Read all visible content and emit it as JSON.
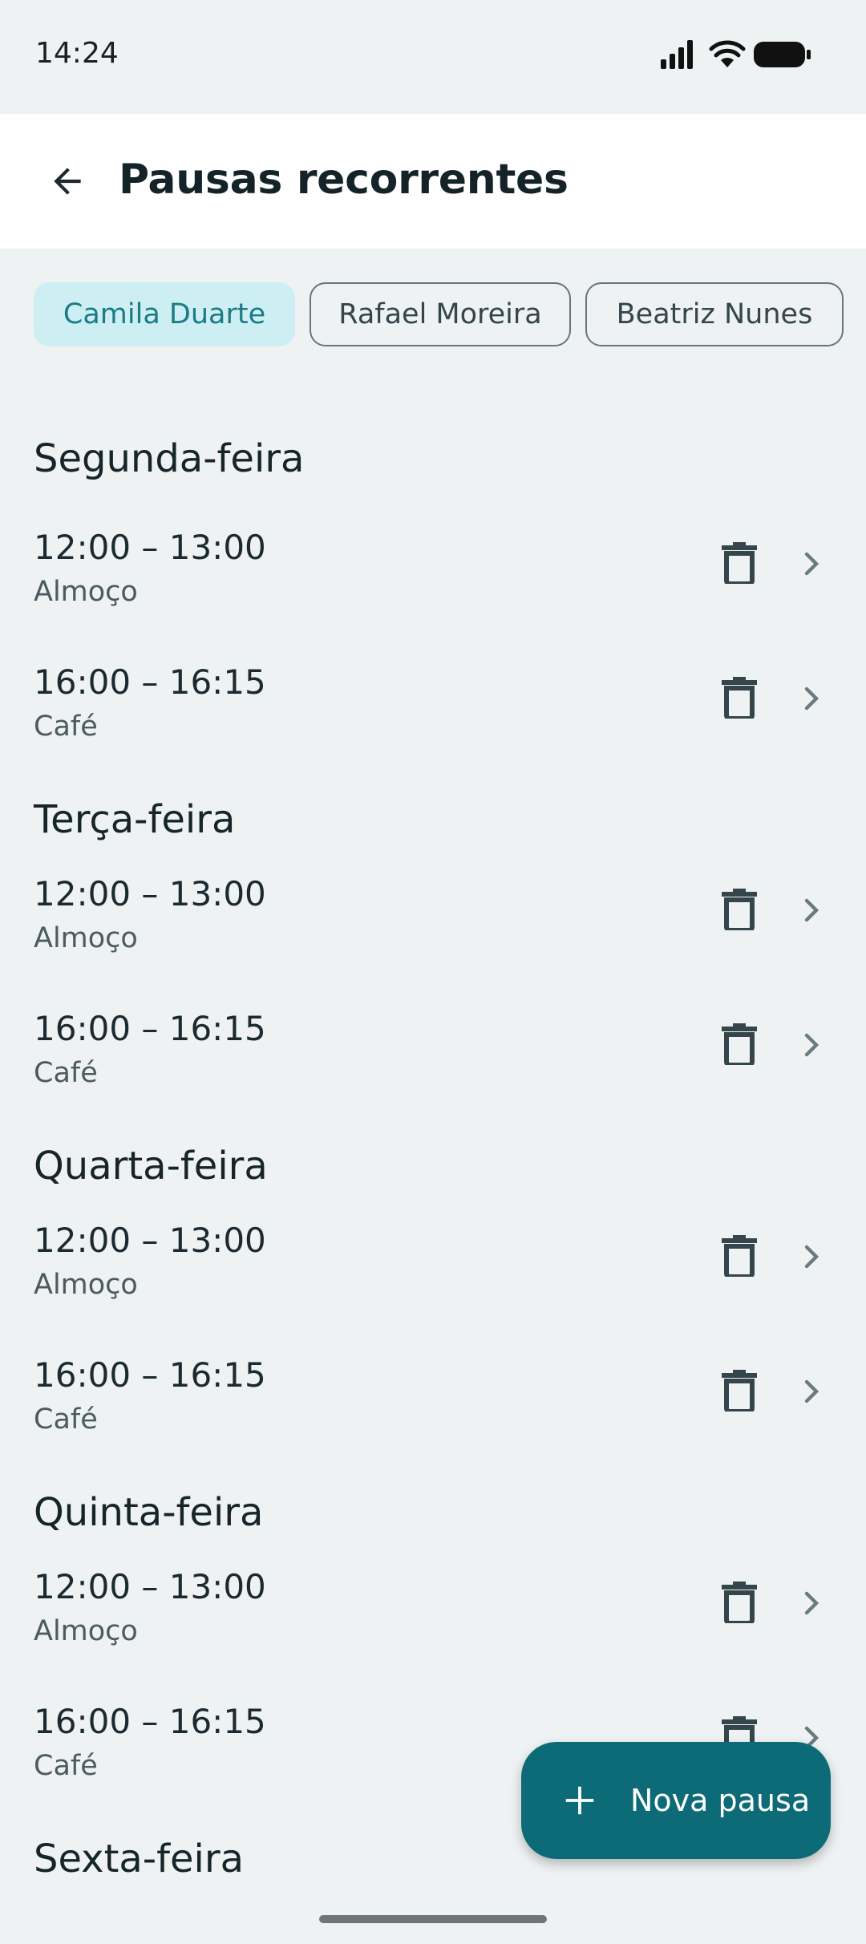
{
  "status_bar": {
    "time": "14:24"
  },
  "header": {
    "title": "Pausas recorrentes"
  },
  "chips": [
    {
      "label": "Camila Duarte",
      "selected": true
    },
    {
      "label": "Rafael Moreira",
      "selected": false
    },
    {
      "label": "Beatriz Nunes",
      "selected": false
    }
  ],
  "days": [
    {
      "name": "Segunda-feira",
      "breaks": [
        {
          "time": "12:00 – 13:00",
          "label": "Almoço"
        },
        {
          "time": "16:00 – 16:15",
          "label": "Café"
        }
      ]
    },
    {
      "name": "Terça-feira",
      "breaks": [
        {
          "time": "12:00 – 13:00",
          "label": "Almoço"
        },
        {
          "time": "16:00 – 16:15",
          "label": "Café"
        }
      ]
    },
    {
      "name": "Quarta-feira",
      "breaks": [
        {
          "time": "12:00 – 13:00",
          "label": "Almoço"
        },
        {
          "time": "16:00 – 16:15",
          "label": "Café"
        }
      ]
    },
    {
      "name": "Quinta-feira",
      "breaks": [
        {
          "time": "12:00 – 13:00",
          "label": "Almoço"
        },
        {
          "time": "16:00 – 16:15",
          "label": "Café"
        }
      ]
    },
    {
      "name": "Sexta-feira",
      "breaks": []
    }
  ],
  "fab": {
    "label": "Nova pausa"
  },
  "icons": {
    "back": "arrow-back-icon",
    "delete": "trash-icon",
    "chevron": "chevron-right-icon",
    "add": "plus-icon"
  },
  "colors": {
    "background": "#eef2f3",
    "primary": "#0c6b77",
    "chip_selected_bg": "#cdeef2",
    "chip_selected_text": "#1b7c86"
  }
}
